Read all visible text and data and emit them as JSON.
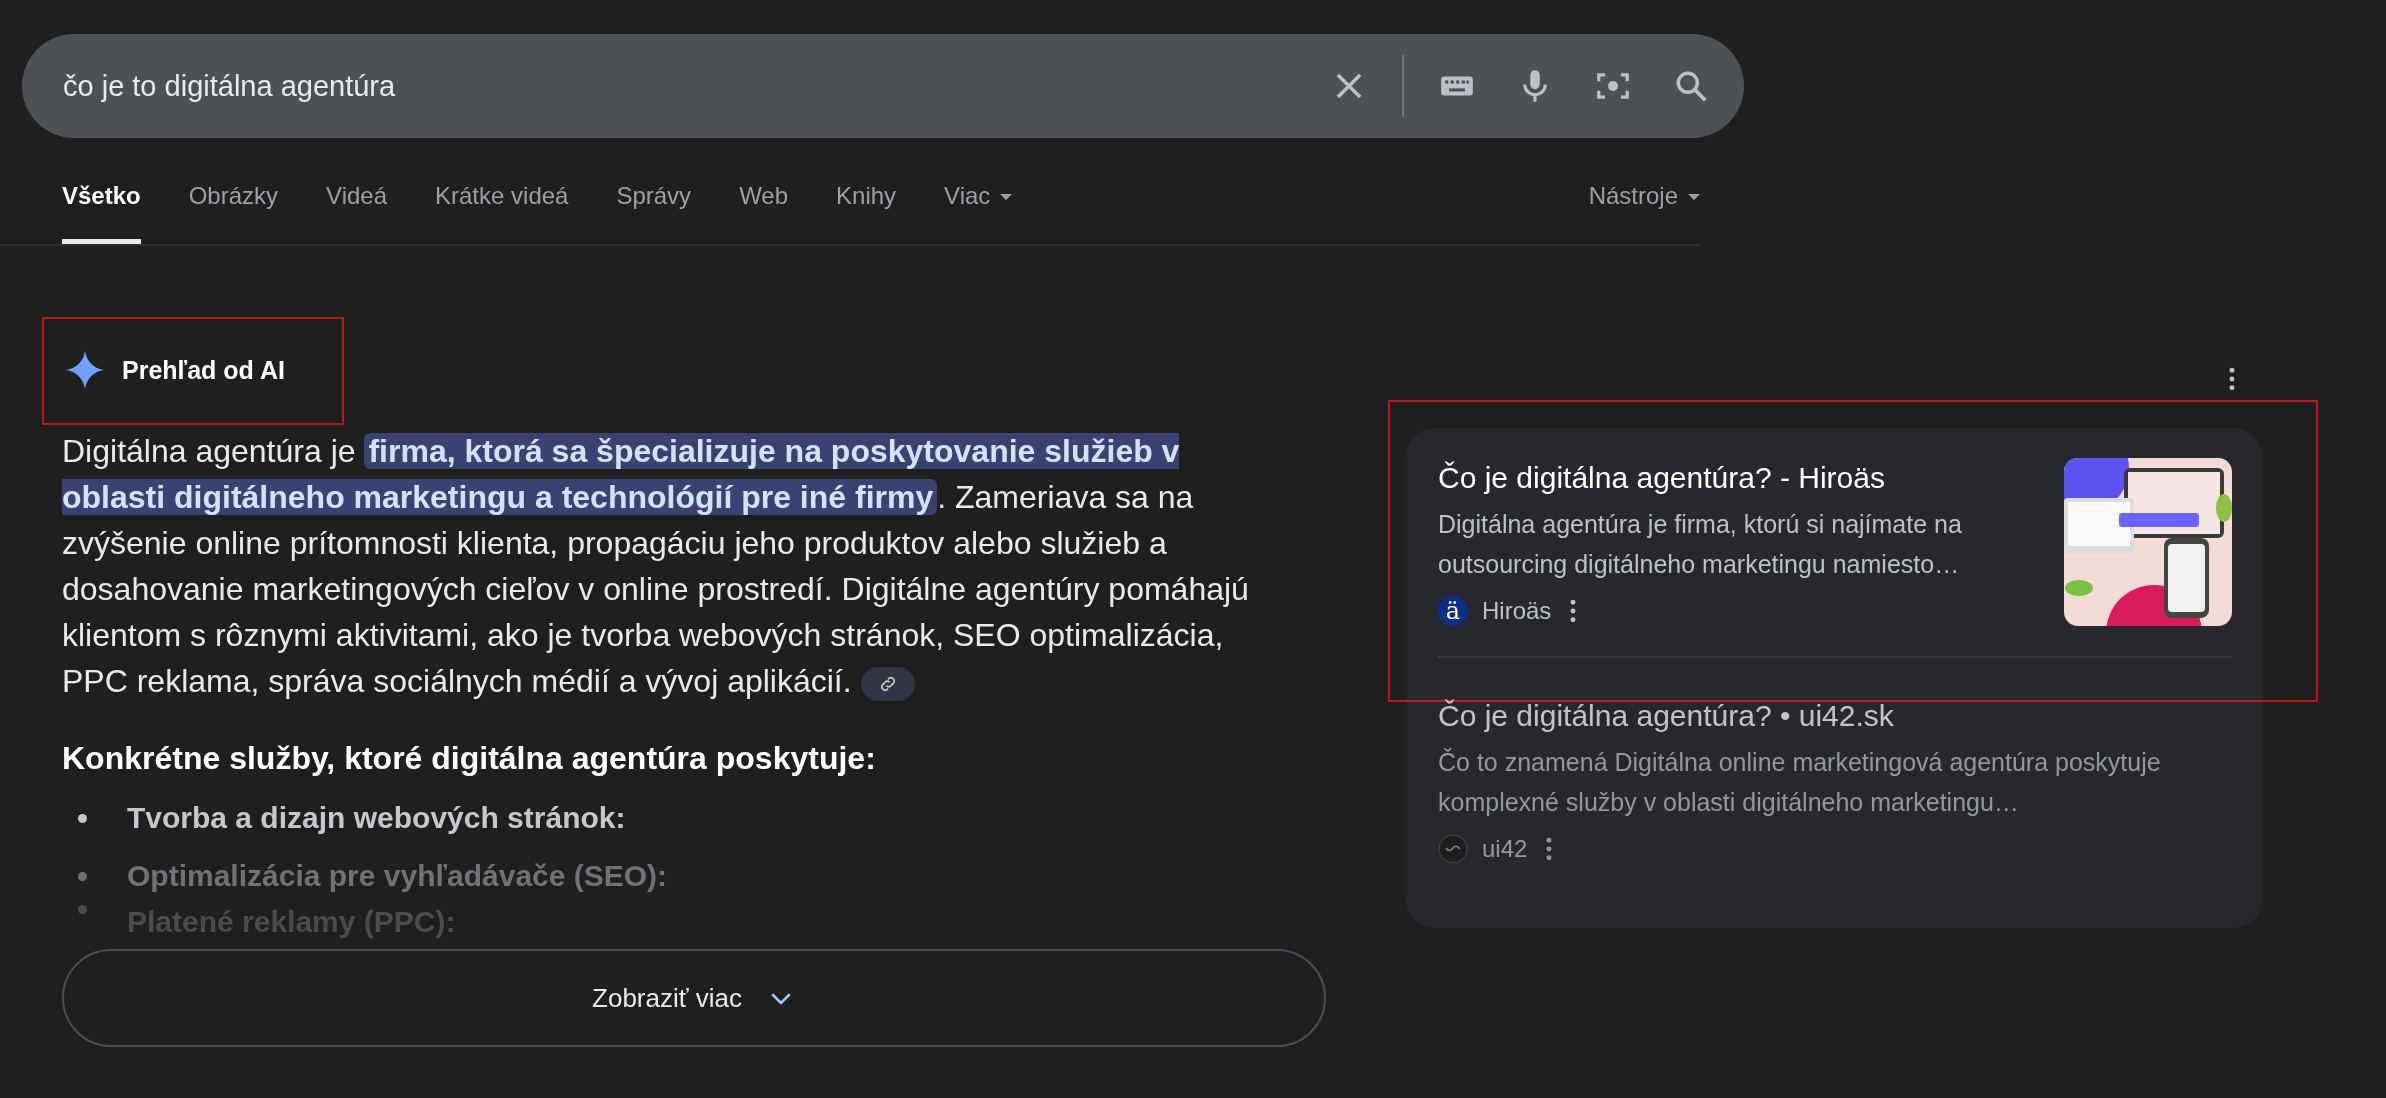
{
  "search": {
    "value": "čo je to digitálna agentúra"
  },
  "tabs": [
    {
      "label": "Všetko",
      "selected": true,
      "dropdown": false
    },
    {
      "label": "Obrázky",
      "selected": false,
      "dropdown": false
    },
    {
      "label": "Videá",
      "selected": false,
      "dropdown": false
    },
    {
      "label": "Krátke videá",
      "selected": false,
      "dropdown": false
    },
    {
      "label": "Správy",
      "selected": false,
      "dropdown": false
    },
    {
      "label": "Web",
      "selected": false,
      "dropdown": false
    },
    {
      "label": "Knihy",
      "selected": false,
      "dropdown": false
    },
    {
      "label": "Viac",
      "selected": false,
      "dropdown": true
    }
  ],
  "tools": {
    "label": "Nástroje"
  },
  "ai_overview": {
    "title": "Prehľad od AI",
    "highlighted": true,
    "paragraph": {
      "before": "Digitálna agentúra je ",
      "highlight": "firma, ktorá sa špecializuje na poskytovanie služieb v oblasti digitálneho marketingu a technológií pre iné firmy",
      "after": ". Zameriava sa na zvýšenie online prítomnosti klienta, propagáciu jeho produktov alebo služieb a dosahovanie marketingových cieľov v online prostredí. Digitálne agentúry pomáhajú klientom s rôznymi aktivitami, ako je tvorba webových stránok, SEO optimalizácia, PPC reklama, správa sociálnych médií a vývoj aplikácií."
    },
    "heading": "Konkrétne služby, ktoré digitálna agentúra poskytuje:",
    "bullets": [
      "Tvorba a dizajn webových stránok:",
      "Optimalizácia pre vyhľadávače (SEO):",
      "Platené reklamy (PPC):"
    ],
    "more_button": "Zobraziť viac"
  },
  "sources": [
    {
      "title": "Čo je digitálna agentúra? - Hiroäs",
      "snippet": "Digitálna agentúra je firma, ktorú si najímate na outsourcing digitálneho marketingu namiesto…",
      "site": "Hiroäs",
      "favicon": "ä",
      "has_image": true,
      "highlighted": true
    },
    {
      "title": "Čo je digitálna agentúra? • ui42.sk",
      "snippet": "Čo to znamená Digitálna online marketingová agentúra poskytuje komplexné služby v oblasti digitálneho marketingu…",
      "site": "ui42",
      "has_image": false,
      "highlighted": false
    }
  ]
}
